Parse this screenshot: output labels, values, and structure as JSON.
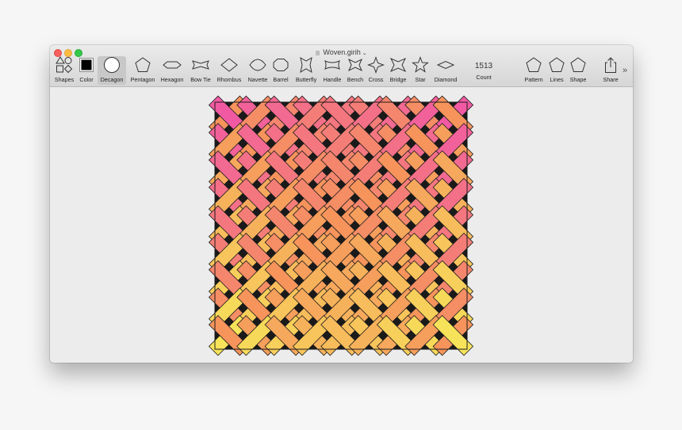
{
  "window": {
    "title": "Woven.girih"
  },
  "toolbar": {
    "shapes": "Shapes",
    "color": "Color",
    "decagon": "Decagon",
    "pentagon": "Pentagon",
    "hexagon": "Hexagon",
    "bowtie": "Bow Tie",
    "rhombus": "Rhombus",
    "navette": "Navette",
    "barrel": "Barrel",
    "butterfly": "Butterfly",
    "handle": "Handle",
    "bench": "Bench",
    "cross": "Cross",
    "bridge": "Bridge",
    "star": "Star",
    "diamond": "Diamond",
    "count_value": "1513",
    "count": "Count",
    "pattern": "Pattern",
    "lines": "Lines",
    "shape": "Shape",
    "share": "Share"
  },
  "colors": {
    "selected_color_swatch": "#000000",
    "weave_yellow": "#f7e35a",
    "weave_orange": "#f6945c",
    "weave_pink": "#f15aa3",
    "weave_outline": "#1a1a1a"
  },
  "icons": [
    "shapes-icon",
    "color-swatch-icon",
    "decagon-icon",
    "pentagon-icon",
    "hexagon-icon",
    "bow-tie-icon",
    "rhombus-icon",
    "navette-icon",
    "barrel-icon",
    "butterfly-icon",
    "handle-icon",
    "bench-icon",
    "cross-icon",
    "bridge-icon",
    "star-icon",
    "diamond-icon",
    "pattern-icon",
    "lines-icon",
    "shape-icon",
    "share-icon",
    "overflow-chevron-icon"
  ]
}
